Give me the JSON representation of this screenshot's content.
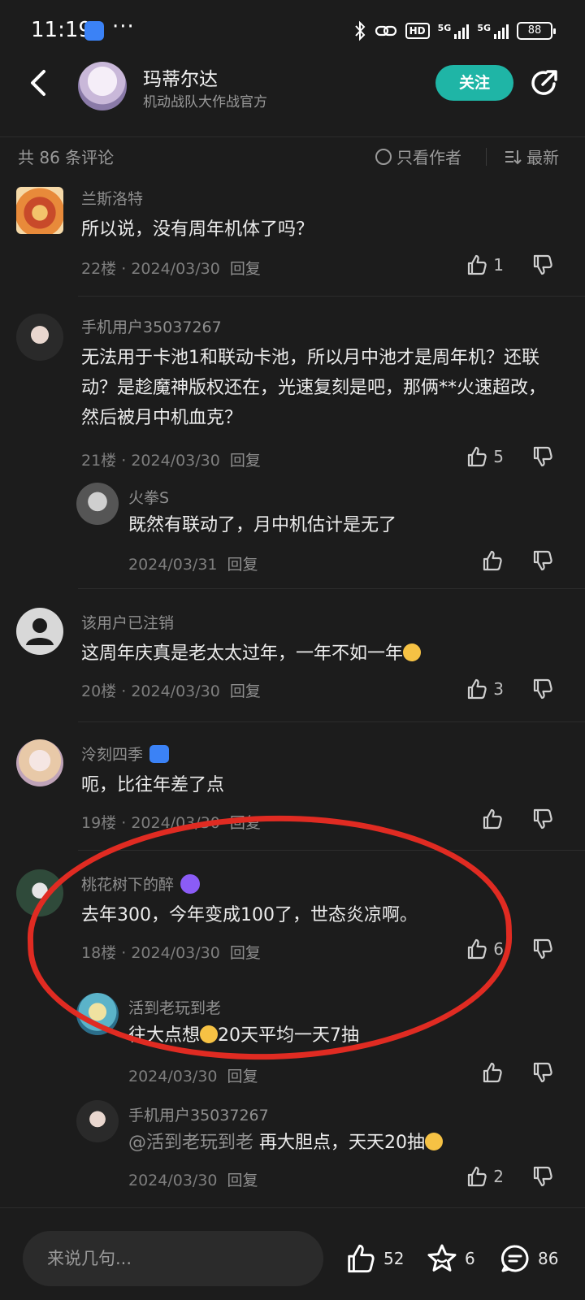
{
  "status_bar": {
    "time": "11:19",
    "more": "···",
    "hd": "HD",
    "net1": "5G",
    "net2": "5G",
    "battery": "88"
  },
  "header": {
    "host_name": "玛蒂尔达",
    "host_subtitle": "机动战队大作战官方",
    "follow_label": "关注"
  },
  "sortbar": {
    "total": "共 86 条评论",
    "author_only": "只看作者",
    "sort_label": "最新"
  },
  "comments": [
    {
      "name": "兰斯洛特",
      "text": "所以说，没有周年机体了吗？",
      "floor": "22楼",
      "date": "2024/03/30",
      "reply": "回复",
      "likes": "1"
    },
    {
      "name": "手机用户35037267",
      "text": "无法用于卡池1和联动卡池，所以月中池才是周年机？还联动？是趁魔神版权还在，光速复刻是吧，那俩**火速超改，然后被月中机血克？",
      "floor": "21楼",
      "date": "2024/03/30",
      "reply": "回复",
      "likes": "5",
      "sub_replies": [
        {
          "name": "火拳S",
          "text": "既然有联动了，月中机估计是无了",
          "date": "2024/03/31",
          "reply": "回复"
        }
      ]
    },
    {
      "name": "该用户已注销",
      "text": "这周年庆真是老太太过年，一年不如一年",
      "floor": "20楼",
      "date": "2024/03/30",
      "reply": "回复",
      "likes": "3"
    },
    {
      "name": "泠刻四季",
      "text": "呃，比往年差了点",
      "floor": "19楼",
      "date": "2024/03/30",
      "reply": "回复"
    },
    {
      "name": "桃花树下的醉",
      "text": "去年300，今年变成100了，世态炎凉啊。",
      "floor": "18楼",
      "date": "2024/03/30",
      "reply": "回复",
      "likes": "6",
      "sub_replies": [
        {
          "name": "活到老玩到老",
          "text": "往大点想",
          "text_tail": "20天平均一天7抽",
          "date": "2024/03/30",
          "reply": "回复"
        },
        {
          "name": "手机用户35037267",
          "mention": "@活到老玩到老",
          "text": " 再大胆点，天天20抽",
          "date": "2024/03/30",
          "reply": "回复",
          "likes": "2"
        }
      ]
    }
  ],
  "bottom_bar": {
    "input_placeholder": "来说几句...",
    "likes": "52",
    "favorites": "6",
    "comments": "86"
  },
  "colors": {
    "background": "#1c1c1c",
    "accent": "#1fb5a6",
    "annotation": "#e02b22"
  }
}
